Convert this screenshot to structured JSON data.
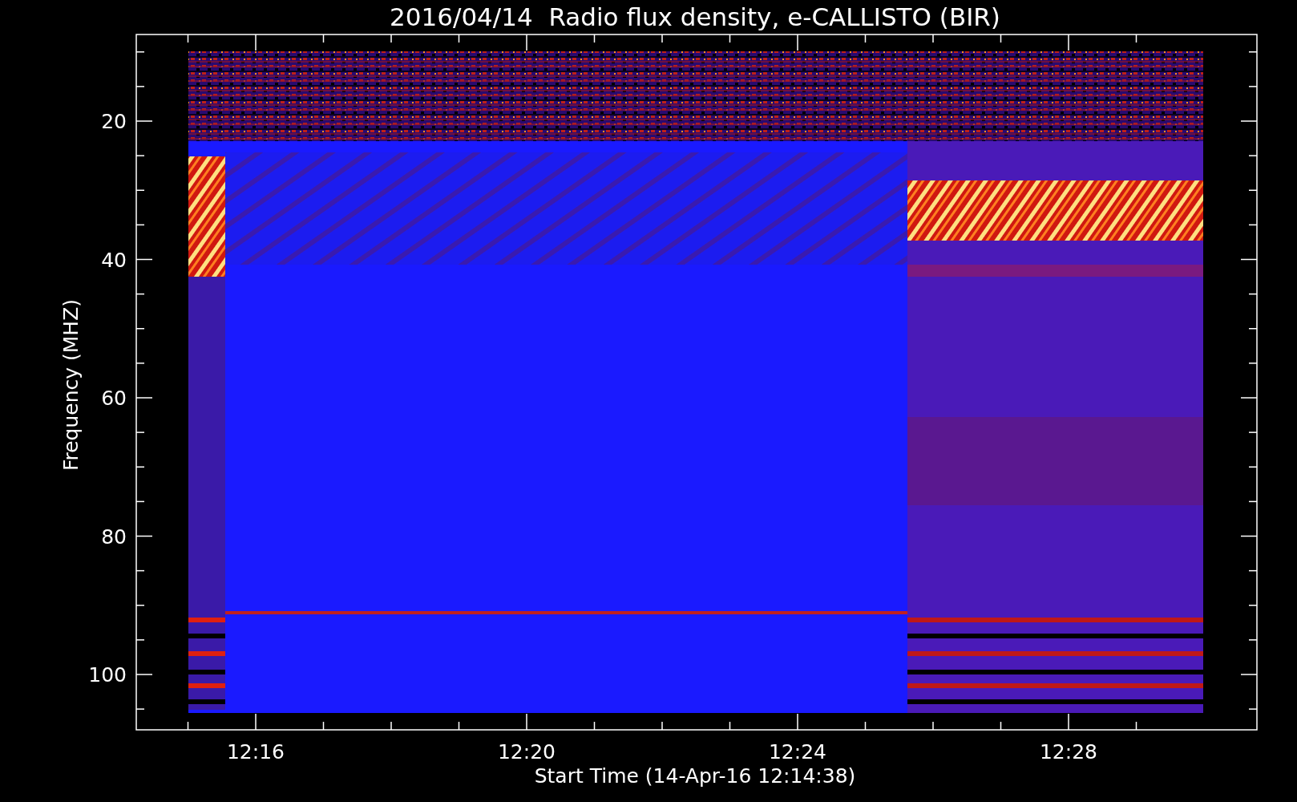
{
  "title": "2016/04/14  Radio flux density, e-CALLISTO (BIR)",
  "y_axis": {
    "label": "Frequency (MHZ)",
    "ticks": [
      "20",
      "40",
      "60",
      "80",
      "100"
    ]
  },
  "x_axis": {
    "label": "Start Time (14-Apr-16 12:14:38)",
    "ticks": [
      "12:16",
      "12:20",
      "12:24",
      "12:28"
    ]
  }
}
